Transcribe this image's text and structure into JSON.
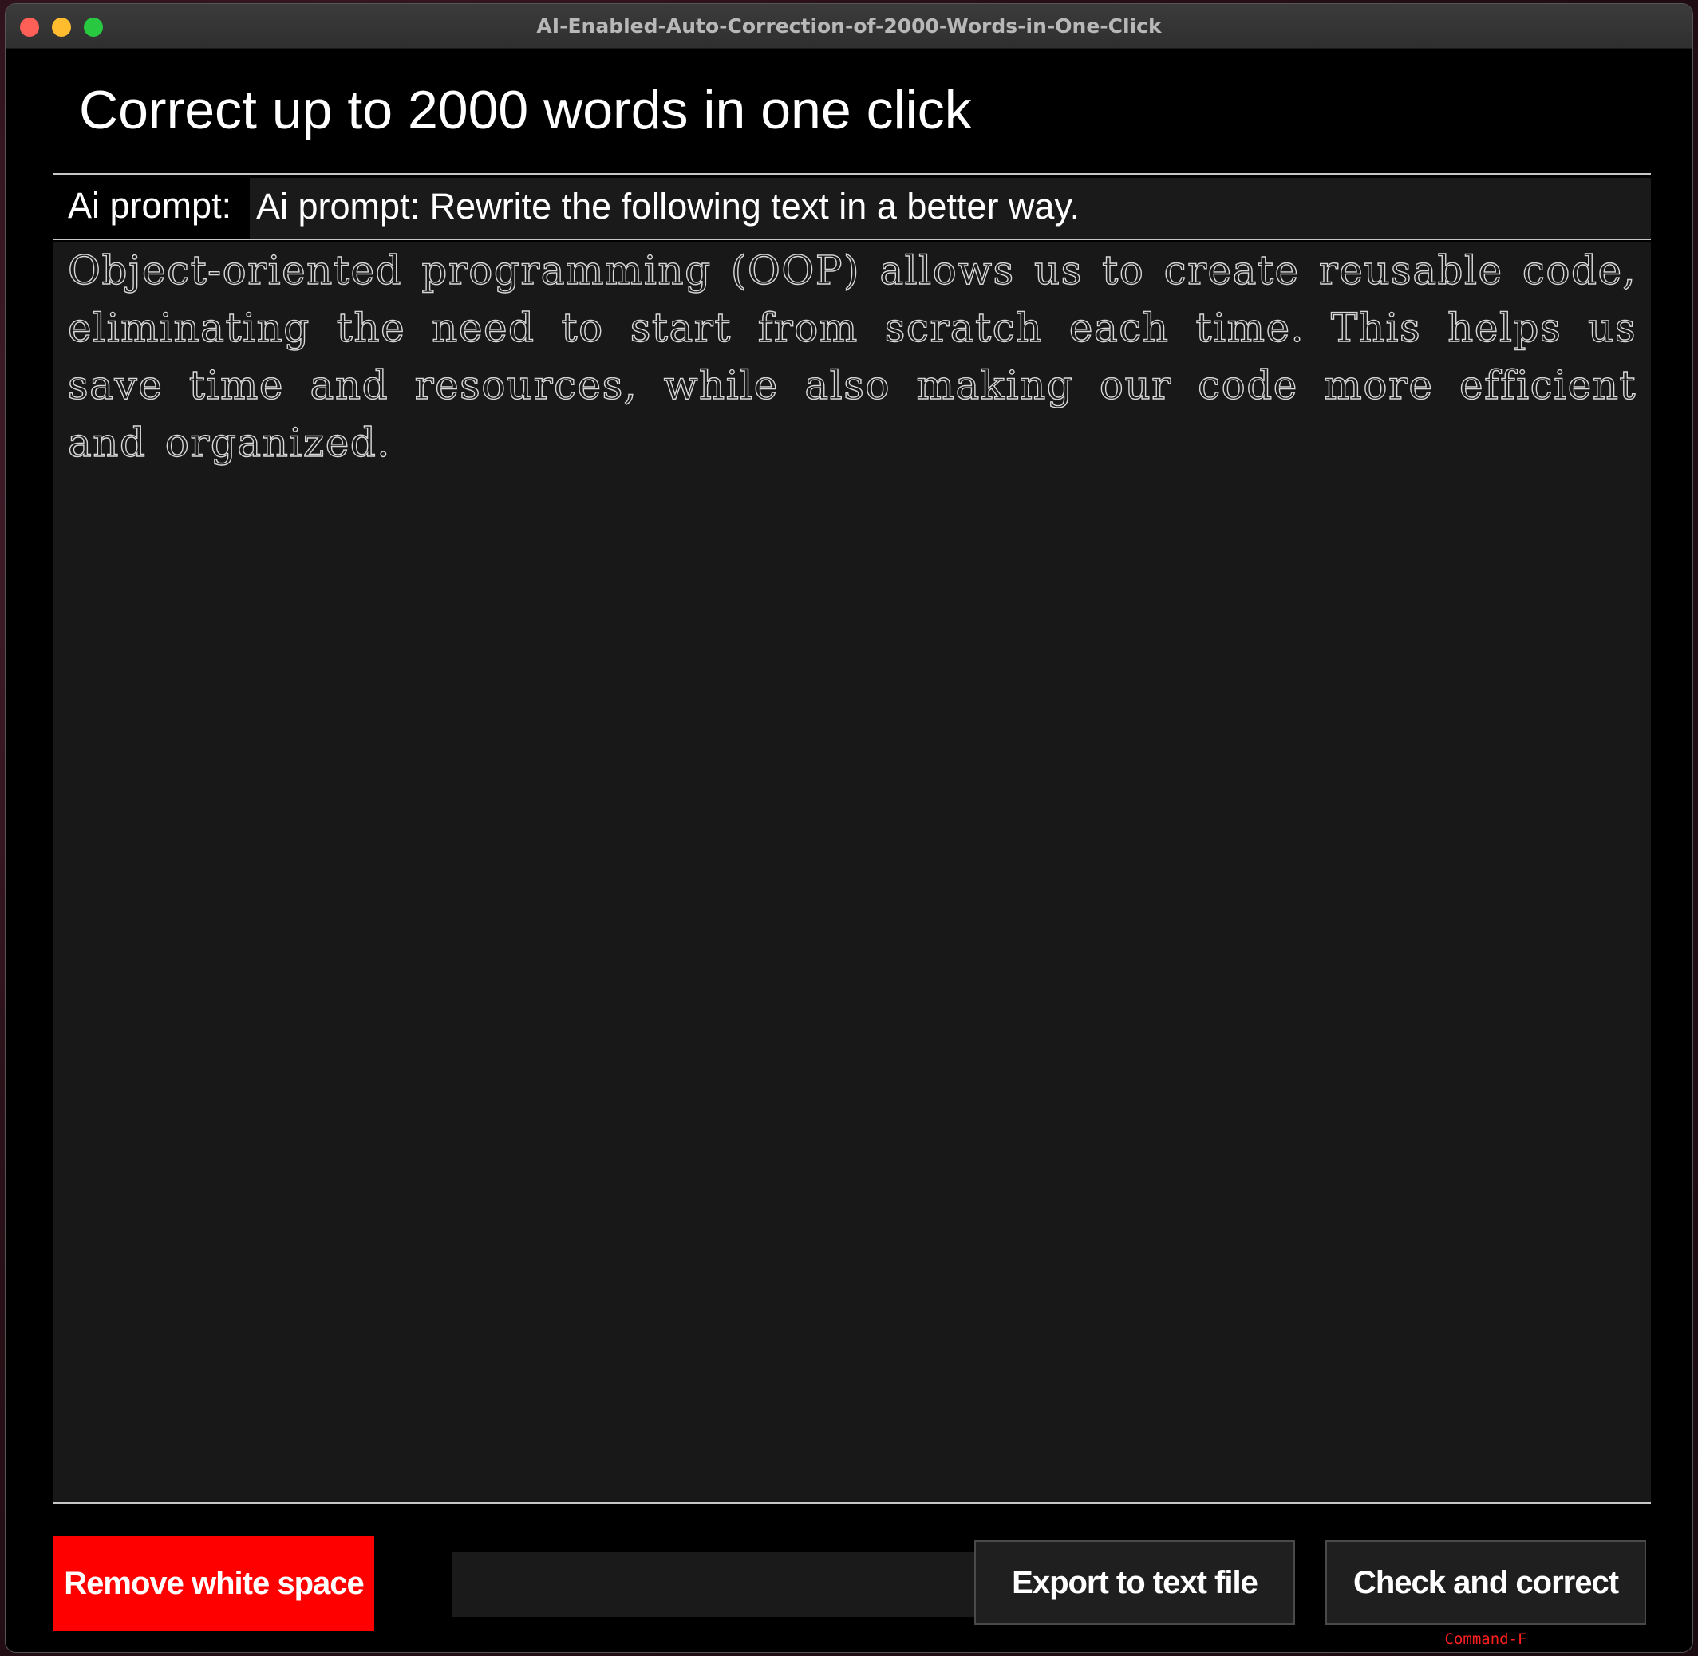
{
  "window": {
    "title": "AI-Enabled-Auto-Correction-of-2000-Words-in-One-Click"
  },
  "header": {
    "title": "Correct up to 2000 words in one click"
  },
  "prompt": {
    "label": "Ai prompt:",
    "value": "Ai prompt: Rewrite the following text in a better way."
  },
  "editor": {
    "text": "Object-oriented programming (OOP) allows us to create reusable code, eliminating the need to start from scratch each time. This helps us save time and resources, while also making our code more efficient and organized."
  },
  "buttons": {
    "remove_whitespace": "Remove white space",
    "export": "Export to text file",
    "check": "Check and correct",
    "check_shortcut": "Command-F"
  },
  "status": {
    "value": ""
  },
  "colors": {
    "remove_button_bg": "#ff0000",
    "shortcut_text": "#ff2020",
    "window_bg": "#000000",
    "editor_bg": "#181818"
  }
}
